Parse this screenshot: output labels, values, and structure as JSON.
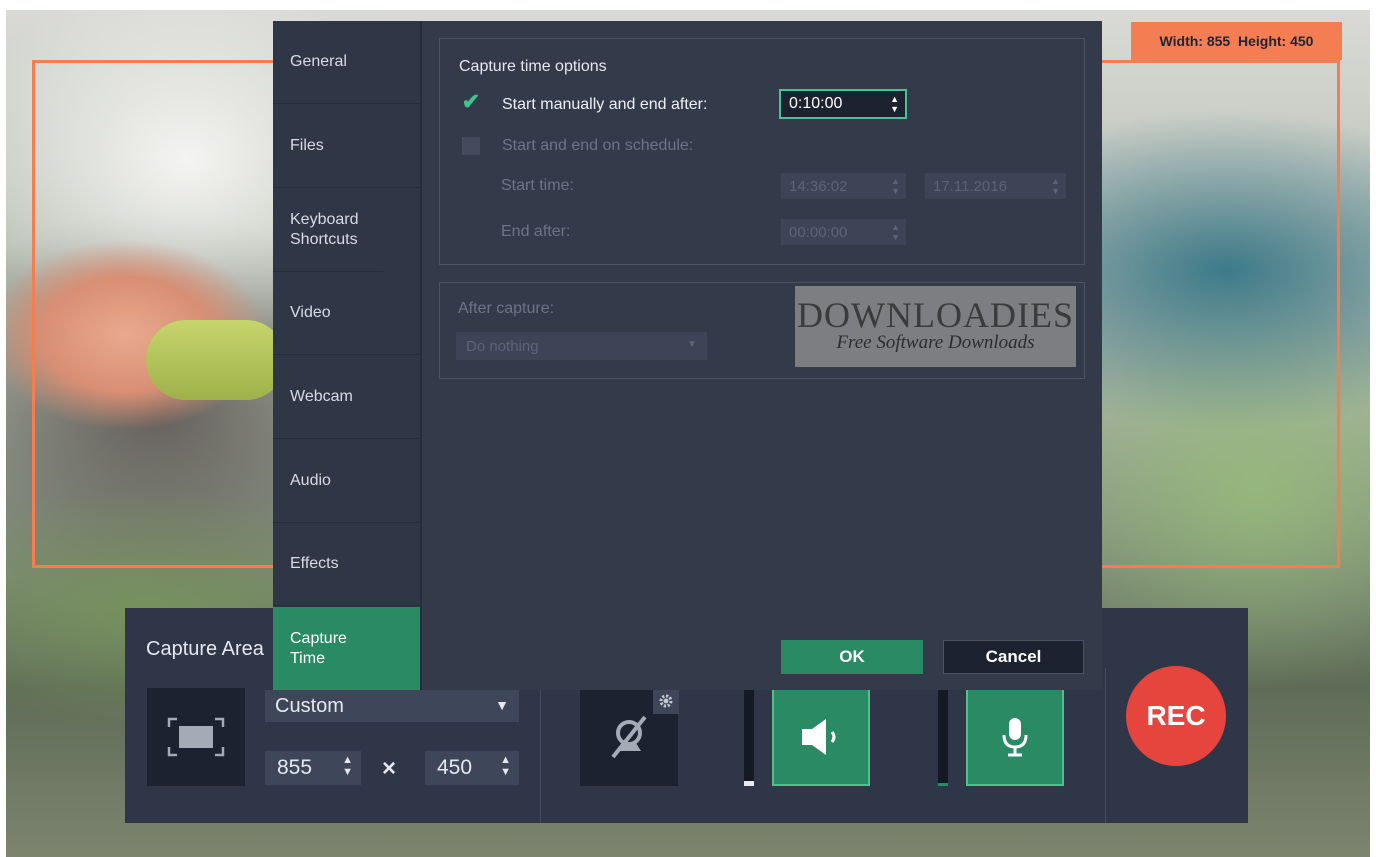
{
  "capture_overlay": {
    "dimensions_label": "Width: 855  Height: 450"
  },
  "toolbar": {
    "title": "Capture Area",
    "preset": "Custom",
    "width_value": "855",
    "height_value": "450",
    "times_symbol": "×",
    "rec_label": "REC",
    "icons": [
      "capture-area-icon",
      "webcam-disabled-icon",
      "gear-icon",
      "speaker-icon",
      "microphone-icon"
    ],
    "speaker_level": 0.05,
    "mic_level": 0.03
  },
  "dialog": {
    "nav": [
      {
        "label": "General"
      },
      {
        "label": "Files"
      },
      {
        "label": "Keyboard Shortcuts"
      },
      {
        "label": "Video"
      },
      {
        "label": "Webcam"
      },
      {
        "label": "Audio"
      },
      {
        "label": "Effects"
      },
      {
        "label": "Capture Time",
        "active": true
      }
    ],
    "capture_time": {
      "title": "Capture time options",
      "manual_label": "Start manually and end after:",
      "manual_checked": true,
      "manual_value": "0:10:00",
      "schedule_label": "Start and end on schedule:",
      "schedule_checked": false,
      "start_time_label": "Start time:",
      "start_time_value": "14:36:02",
      "start_date_value": "17.11.2016",
      "end_after_label": "End after:",
      "end_after_value": "00:00:00"
    },
    "after_capture": {
      "label": "After capture:",
      "value": "Do nothing"
    },
    "watermark": {
      "big": "DOWNLOADIES",
      "small": "Free Software Downloads"
    },
    "ok_label": "OK",
    "cancel_label": "Cancel"
  },
  "colors": {
    "accent_green": "#2a8a63",
    "frame_orange": "#f47e52",
    "rec_red": "#e6453d",
    "panel_dark": "#333a4a"
  }
}
